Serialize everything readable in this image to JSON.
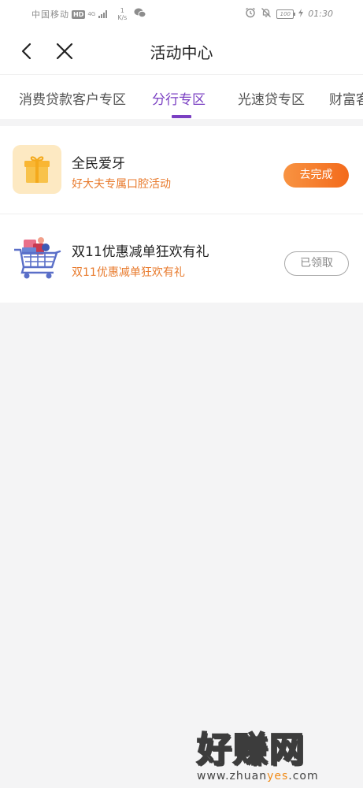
{
  "status_bar": {
    "carrier": "中国移动",
    "hd": "HD",
    "network": "4G",
    "speed_value": "1",
    "speed_unit": "K/s",
    "battery": "100",
    "time": "01:30"
  },
  "nav": {
    "title": "活动中心"
  },
  "tabs": [
    {
      "label": "消费贷款客户专区",
      "active": false
    },
    {
      "label": "分行专区",
      "active": true
    },
    {
      "label": "光速贷专区",
      "active": false
    },
    {
      "label": "财富客",
      "active": false
    }
  ],
  "activities": [
    {
      "title": "全民爱牙",
      "subtitle": "好大夫专属口腔活动",
      "button": "去完成",
      "icon": "gift-icon"
    },
    {
      "title": "双11优惠减单狂欢有礼",
      "subtitle": "双11优惠减单狂欢有礼",
      "button": "已领取",
      "icon": "shopping-cart-icon"
    }
  ],
  "watermark": {
    "brand": "好赚网",
    "url_prefix": "www.zhuan",
    "url_highlight": "yes",
    "url_suffix": ".com"
  },
  "colors": {
    "accent": "#7a3fc2",
    "orange": "#e87a2c",
    "button_gradient_start": "#f89342",
    "button_gradient_end": "#f36a1b"
  }
}
